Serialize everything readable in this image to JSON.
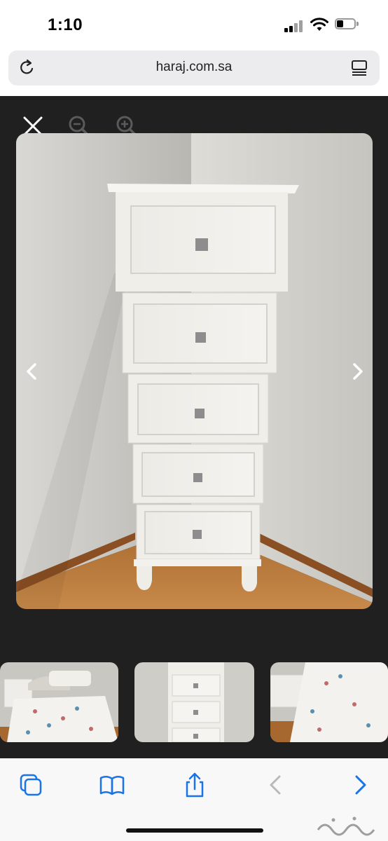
{
  "status_bar": {
    "time": "1:10"
  },
  "browser": {
    "url": "haraj.com.sa"
  },
  "icons": {
    "reload": "reload-icon",
    "tabs": "tabs-overview-icon",
    "close": "close-icon",
    "zoom_out": "zoom-out-icon",
    "zoom_in": "zoom-in-icon",
    "previous": "chevron-left-icon",
    "next": "chevron-right-icon",
    "toolbar": [
      "tabs-icon",
      "bookmarks-icon",
      "share-icon",
      "back-icon",
      "forward-icon"
    ]
  },
  "gallery": {
    "thumbnail_count": 3
  },
  "colors": {
    "viewer_bg": "#202020",
    "accent": "#1a73e8",
    "toolbar_bg": "#f8f8f8",
    "disabled": "#b9b9b9"
  }
}
